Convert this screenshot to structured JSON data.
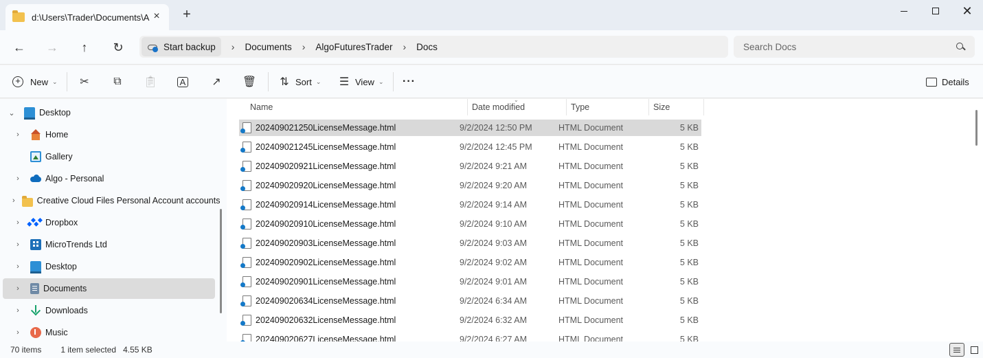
{
  "window": {
    "tab_title": "d:\\Users\\Trader\\Documents\\A",
    "tab_close": "×",
    "new_tab": "+",
    "close_glyph": "✕"
  },
  "address": {
    "backup_label": "Start backup",
    "breadcrumbs": [
      "Documents",
      "AlgoFuturesTrader",
      "Docs"
    ],
    "search_placeholder": "Search Docs"
  },
  "toolbar": {
    "new_label": "New",
    "sort_label": "Sort",
    "view_label": "View",
    "more_label": "···",
    "details_label": "Details"
  },
  "nav": {
    "items": [
      {
        "label": "Desktop",
        "icon": "desktop-icon",
        "expanded": true
      },
      {
        "label": "Home",
        "icon": "home-icon"
      },
      {
        "label": "Gallery",
        "icon": "gallery-icon"
      },
      {
        "label": "Algo - Personal",
        "icon": "onedrive-icon"
      },
      {
        "label": "Creative Cloud Files Personal Account accounts",
        "icon": "folder-icon"
      },
      {
        "label": "Dropbox",
        "icon": "dropbox-icon"
      },
      {
        "label": "MicroTrends Ltd",
        "icon": "building-icon"
      },
      {
        "label": "Desktop",
        "icon": "desktop-icon"
      },
      {
        "label": "Documents",
        "icon": "documents-icon",
        "selected": true
      },
      {
        "label": "Downloads",
        "icon": "downloads-icon"
      },
      {
        "label": "Music",
        "icon": "music-icon"
      }
    ]
  },
  "columns": {
    "name": "Name",
    "date": "Date modified",
    "type": "Type",
    "size": "Size"
  },
  "files": [
    {
      "name": "202409021250LicenseMessage.html",
      "date": "9/2/2024 12:50 PM",
      "type": "HTML Document",
      "size": "5 KB",
      "selected": true
    },
    {
      "name": "202409021245LicenseMessage.html",
      "date": "9/2/2024 12:45 PM",
      "type": "HTML Document",
      "size": "5 KB"
    },
    {
      "name": "202409020921LicenseMessage.html",
      "date": "9/2/2024 9:21 AM",
      "type": "HTML Document",
      "size": "5 KB"
    },
    {
      "name": "202409020920LicenseMessage.html",
      "date": "9/2/2024 9:20 AM",
      "type": "HTML Document",
      "size": "5 KB"
    },
    {
      "name": "202409020914LicenseMessage.html",
      "date": "9/2/2024 9:14 AM",
      "type": "HTML Document",
      "size": "5 KB"
    },
    {
      "name": "202409020910LicenseMessage.html",
      "date": "9/2/2024 9:10 AM",
      "type": "HTML Document",
      "size": "5 KB"
    },
    {
      "name": "202409020903LicenseMessage.html",
      "date": "9/2/2024 9:03 AM",
      "type": "HTML Document",
      "size": "5 KB"
    },
    {
      "name": "202409020902LicenseMessage.html",
      "date": "9/2/2024 9:02 AM",
      "type": "HTML Document",
      "size": "5 KB"
    },
    {
      "name": "202409020901LicenseMessage.html",
      "date": "9/2/2024 9:01 AM",
      "type": "HTML Document",
      "size": "5 KB"
    },
    {
      "name": "202409020634LicenseMessage.html",
      "date": "9/2/2024 6:34 AM",
      "type": "HTML Document",
      "size": "5 KB"
    },
    {
      "name": "202409020632LicenseMessage.html",
      "date": "9/2/2024 6:32 AM",
      "type": "HTML Document",
      "size": "5 KB"
    },
    {
      "name": "202409020627LicenseMessage.html",
      "date": "9/2/2024 6:27 AM",
      "type": "HTML Document",
      "size": "5 KB"
    }
  ],
  "status": {
    "item_count": "70 items",
    "selected_info": "1 item selected",
    "selected_size": "4.55 KB"
  }
}
